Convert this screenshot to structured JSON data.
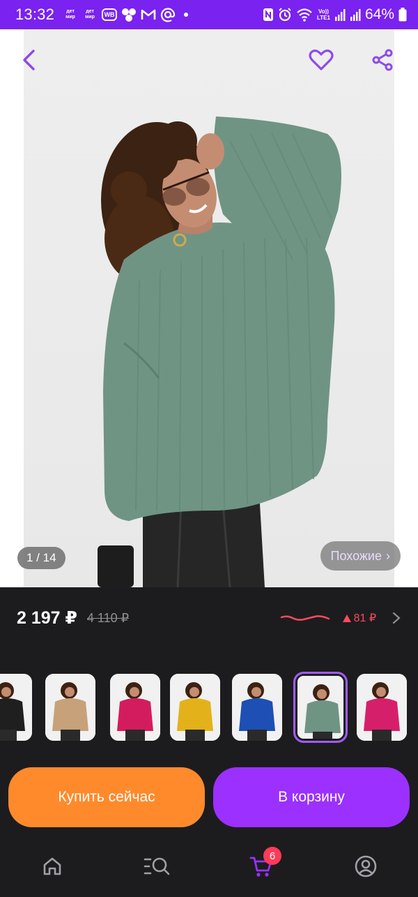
{
  "status_bar": {
    "time": "13:32",
    "badge1_top": "дет",
    "badge1_bottom": "мир",
    "badge2_top": "дет",
    "badge2_bottom": "мир",
    "wb_label": "WB",
    "volte_top": "Vo))",
    "volte_bottom": "LTE1",
    "battery": "64%",
    "icons": [
      "detmir-icon",
      "detmir-icon",
      "wildberries-icon",
      "dots-icon",
      "gmail-icon",
      "at-icon",
      "dot-icon",
      "nfc-icon",
      "alarm-icon",
      "wifi-icon",
      "signal-icon",
      "signal-icon",
      "battery-icon"
    ]
  },
  "product": {
    "photo_counter": "1 / 14",
    "similar_label": "Похожие",
    "similar_chevron": "›",
    "sweater_color": "#6f9484"
  },
  "price": {
    "current": "2 197 ₽",
    "old": "4 110 ₽",
    "change": "81 ₽",
    "change_direction": "up",
    "change_color": "#ff4a5e"
  },
  "thumbnails": [
    {
      "label": "black-sweater",
      "color": "#1f1f1f",
      "selected": false
    },
    {
      "label": "beige-sweater",
      "color": "#c7a17a",
      "selected": false
    },
    {
      "label": "raspberry-sweater",
      "color": "#d31c5e",
      "selected": false
    },
    {
      "label": "yellow-sweater",
      "color": "#e3b21b",
      "selected": false
    },
    {
      "label": "blue-sweater",
      "color": "#1e4fb4",
      "selected": false
    },
    {
      "label": "green-sweater",
      "color": "#6f9484",
      "selected": true
    },
    {
      "label": "pink-sweater",
      "color": "#d61f6a",
      "selected": false
    }
  ],
  "actions": {
    "buy_now": "Купить сейчас",
    "add_to_cart": "В корзину",
    "buy_color": "#ff8a2b",
    "cart_color": "#9b30ff"
  },
  "nav": {
    "cart_count": "6",
    "items": [
      "home-icon",
      "catalog-search-icon",
      "cart-icon",
      "profile-icon"
    ]
  }
}
